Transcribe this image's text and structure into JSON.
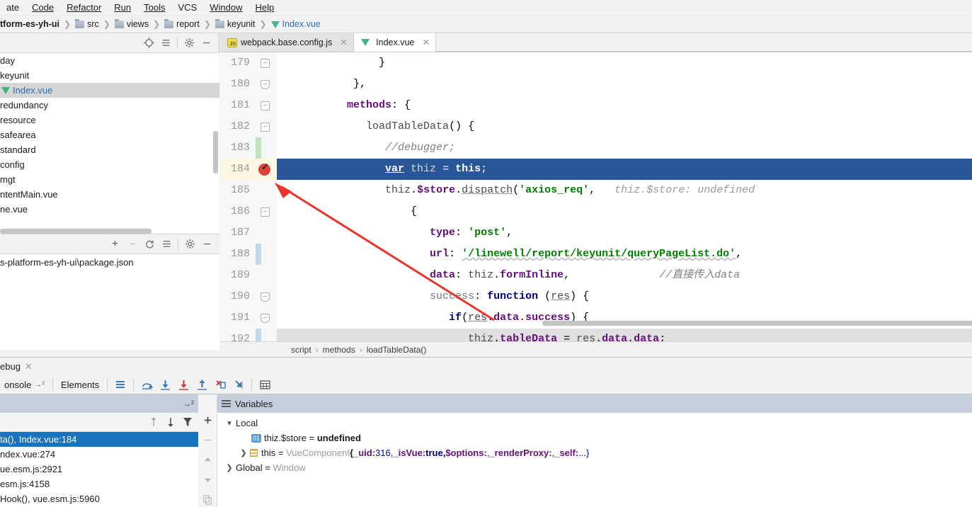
{
  "menu": {
    "items": [
      {
        "label": "ate"
      },
      {
        "label": "Code"
      },
      {
        "label": "Refactor"
      },
      {
        "label": "Run"
      },
      {
        "label": "Tools"
      },
      {
        "label": "VCS"
      },
      {
        "label": "Window"
      },
      {
        "label": "Help"
      }
    ]
  },
  "breadcrumb": {
    "project": "tform-es-yh-ui",
    "items": [
      "src",
      "views",
      "report",
      "keyunit"
    ],
    "file": "Index.vue"
  },
  "project_panel": {
    "tree": [
      {
        "label": "day",
        "type": "folder",
        "selected": false
      },
      {
        "label": "keyunit",
        "type": "folder",
        "selected": false
      },
      {
        "label": "Index.vue",
        "type": "vue",
        "selected": true
      },
      {
        "label": "redundancy",
        "type": "folder",
        "selected": false
      },
      {
        "label": "resource",
        "type": "folder",
        "selected": false
      },
      {
        "label": "safearea",
        "type": "folder",
        "selected": false
      },
      {
        "label": "standard",
        "type": "folder",
        "selected": false
      },
      {
        "label": "config",
        "type": "folder",
        "selected": false
      },
      {
        "label": "mgt",
        "type": "folder",
        "selected": false
      },
      {
        "label": "ntentMain.vue",
        "type": "vue",
        "selected": false
      },
      {
        "label": "ne.vue",
        "type": "vue",
        "selected": false
      }
    ],
    "npm": [
      {
        "label": "s-platform-es-yh-ui\\package.json"
      }
    ],
    "toolbar_icons": [
      "locate-icon",
      "collapse-all-icon",
      "gear-icon",
      "minimize-icon"
    ],
    "toolbar2_icons": [
      "add-icon",
      "remove-icon",
      "refresh-icon",
      "collapse-all-icon",
      "gear-icon",
      "minimize-icon"
    ]
  },
  "editor": {
    "tabs": [
      {
        "label": "webpack.base.config.js",
        "icon": "js-file-icon",
        "active": false
      },
      {
        "label": "Index.vue",
        "icon": "vue-file-icon",
        "active": true
      }
    ],
    "lines": [
      {
        "num": "179",
        "fold": "minus"
      },
      {
        "num": "180",
        "fold": "arrow"
      },
      {
        "num": "181",
        "fold": "minus"
      },
      {
        "num": "182",
        "fold": "minus"
      },
      {
        "num": "183",
        "fold": "",
        "stripe": "green"
      },
      {
        "num": "184",
        "fold": "",
        "breakpoint": true,
        "current": true
      },
      {
        "num": "185",
        "fold": ""
      },
      {
        "num": "186",
        "fold": "minus"
      },
      {
        "num": "187",
        "fold": ""
      },
      {
        "num": "188",
        "fold": "",
        "stripe": "blue"
      },
      {
        "num": "189",
        "fold": ""
      },
      {
        "num": "190",
        "fold": "arrow"
      },
      {
        "num": "191",
        "fold": "arrow"
      },
      {
        "num": "192",
        "fold": "",
        "stripe": "blue"
      }
    ],
    "breadcrumb": [
      "script",
      "methods",
      "loadTableData()"
    ],
    "inline_hints": {
      "store_undefined": "thiz.$store: undefined",
      "data_comment": "//直接传入data"
    }
  },
  "debug": {
    "tab_label": "ebug",
    "toolbar_tabs": [
      "onsole",
      "Elements"
    ],
    "toolbar_icons": [
      "menu-icon",
      "step-over-icon",
      "step-into-icon",
      "force-step-into-icon",
      "step-out-icon",
      "run-to-cursor-icon",
      "drop-frame-icon",
      "evaluate-icon"
    ],
    "frames": {
      "tools": [
        "sort-up-icon",
        "sort-down-icon",
        "filter-icon",
        "add-icon"
      ],
      "rows": [
        {
          "label": "ta(), Index.vue:184",
          "selected": true
        },
        {
          "label": "ndex.vue:274",
          "selected": false
        },
        {
          "label": "ue.esm.js:2921",
          "selected": false
        },
        {
          "label": "esm.js:4158",
          "selected": false
        },
        {
          "label": "Hook(), vue.esm.js:5960",
          "selected": false
        }
      ],
      "vtools": [
        "add-icon",
        "remove-icon",
        "move-up-icon",
        "move-down-icon",
        "copy-icon"
      ]
    },
    "variables": {
      "title": "Variables",
      "rows": [
        {
          "kind": "scope",
          "name": "Local",
          "chevron": "expanded"
        },
        {
          "kind": "var",
          "badge": "01",
          "name": "thiz.$store",
          "eq": "=",
          "value": "undefined"
        },
        {
          "kind": "object",
          "chevron": "collapsed",
          "name": "this",
          "eq": "=",
          "type": "VueComponent",
          "preview_open": "{",
          "fields": [
            {
              "key": "_uid:",
              "val": " 316,"
            },
            {
              "key": "_isVue:",
              "val": " true,"
            },
            {
              "key": "$options:",
              "val": " ,"
            },
            {
              "key": "_renderProxy:",
              "val": " ,"
            },
            {
              "key": "_self:",
              "val": " ...}"
            }
          ]
        },
        {
          "kind": "scope",
          "name": "Global",
          "eq": "=",
          "type": "Window",
          "chevron": "collapsed"
        }
      ]
    }
  },
  "colors": {
    "selection_blue": "#2a5699",
    "frame_selected": "#1772c0",
    "accent_green": "#41b883",
    "breakpoint_red": "#db4437",
    "arrow_red": "#e8352b",
    "current_line_yellow": "#fdf6e3"
  }
}
